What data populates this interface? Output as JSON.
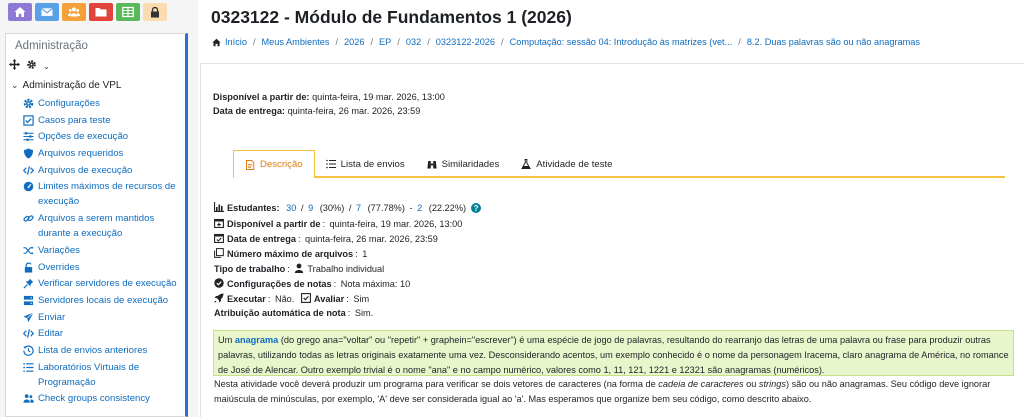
{
  "page_title": "0323122 - Módulo de Fundamentos 1 (2026)",
  "breadcrumb": [
    "Início",
    "Meus Ambientes",
    "2026",
    "EP",
    "032",
    "0323122-2026",
    "Computação: sessão 04: Introdução às matrizes (vet...",
    "8.2. Duas palavras são ou não anagramas"
  ],
  "colors": {
    "accent": "#f5c242",
    "link": "#0f6cbf",
    "tab_active": "#e07b12",
    "highlight_bg": "#e9f6cc"
  },
  "quick_links": [
    {
      "icon": "home-icon",
      "color": "#8e79d6"
    },
    {
      "icon": "mail-icon",
      "color": "#5aa2e8"
    },
    {
      "icon": "users-icon",
      "color": "#f5a03a"
    },
    {
      "icon": "folder-icon",
      "color": "#e0443a"
    },
    {
      "icon": "table-icon",
      "color": "#5cb85c"
    },
    {
      "icon": "lock-icon",
      "color": "#fbdcb0"
    }
  ],
  "admin": {
    "title": "Administração",
    "section": "Administração de VPL",
    "items": [
      {
        "label": "Configurações",
        "icon": "gear-icon"
      },
      {
        "label": "Casos para teste",
        "icon": "checkbox-icon"
      },
      {
        "label": "Opções de execução",
        "icon": "sliders-icon"
      },
      {
        "label": "Arquivos requeridos",
        "icon": "shield-icon"
      },
      {
        "label": "Arquivos de execução",
        "icon": "code-icon"
      },
      {
        "label": "Limites máximos de recursos de execução",
        "icon": "gauge-icon"
      },
      {
        "label": "Arquivos a serem mantidos durante a execução",
        "icon": "link-icon"
      },
      {
        "label": "Variações",
        "icon": "shuffle-icon"
      },
      {
        "label": "Overrides",
        "icon": "unlock-icon"
      },
      {
        "label": "Verificar servidores de execução",
        "icon": "pin-icon"
      },
      {
        "label": "Servidores locais de execução",
        "icon": "server-icon"
      },
      {
        "label": "Enviar",
        "icon": "send-icon"
      },
      {
        "label": "Editar",
        "icon": "code-icon"
      },
      {
        "label": "Lista de envios anteriores",
        "icon": "history-icon"
      },
      {
        "label": "Laboratórios Virtuais de Programação",
        "icon": "list-icon"
      },
      {
        "label": "Check groups consistency",
        "icon": "users-icon"
      }
    ]
  },
  "dates": {
    "available_label": "Disponível a partir de:",
    "available_value": "quinta-feira, 19 mar. 2026, 13:00",
    "due_label": "Data de entrega:",
    "due_value": "quinta-feira, 26 mar. 2026, 23:59"
  },
  "tabs": [
    {
      "label": "Descrição",
      "icon": "doc-icon",
      "active": true
    },
    {
      "label": "Lista de envios",
      "icon": "list-icon",
      "active": false
    },
    {
      "label": "Similaridades",
      "icon": "binoculars-icon",
      "active": false
    },
    {
      "label": "Atividade de teste",
      "icon": "flask-icon",
      "active": false
    }
  ],
  "details": {
    "students_label": "Estudantes:",
    "students_total": "30",
    "students_a": "9",
    "students_a_pct": "(30%)",
    "students_b": "7",
    "students_b_pct": "(77.78%)",
    "students_c": "2",
    "students_c_pct": "(22.22%)",
    "available_label": "Disponível a partir de",
    "available_value": "quinta-feira, 19 mar. 2026, 13:00",
    "due_label": "Data de entrega",
    "due_value": "quinta-feira, 26 mar. 2026, 23:59",
    "maxfiles_label": "Número máximo de arquivos",
    "maxfiles_value": "1",
    "worktype_label": "Tipo de trabalho",
    "worktype_value": "Trabalho individual",
    "grade_label": "Configurações de notas",
    "grade_value": "Nota máxima: 10",
    "run_label": "Executar",
    "run_value": "Não.",
    "eval_label": "Avaliar",
    "eval_value": "Sim",
    "autograde_label": "Atribuição automática de nota",
    "autograde_value": "Sim."
  },
  "description": {
    "p1_pre": "Um ",
    "p1_keyword": "anagrama",
    "p1_text": " (do grego ana=\"voltar\" ou \"repetir\" + graphein=\"escrever\") é uma espécie de jogo de palavras, resultando do rearranjo das letras de uma palavra ou frase para produzir outras palavras, utilizando todas as letras originais exatamente uma vez. Desconsiderando acentos, um exemplo conhecido é o nome da personagem Iracema, claro anagrama de América, no romance de José de Alencar. Outro exemplo trivial é o nome \"ana\" e no campo numérico, valores como 1, 11, 121, 1221 e 12321 são anagramas (numéricos).",
    "p2_a": "Nesta atividade você deverá produzir um programa para verificar se dois vetores de caracteres (na forma de ",
    "p2_b": "cadeia de caracteres",
    "p2_c": " ou ",
    "p2_d": "strings",
    "p2_e": ") são ou não anagramas. Seu código deve ignorar maiúscula de minúsculas, por exemplo, 'A' deve ser considerada igual ao 'a'. Mas esperamos que organize bem seu código, como descrito abaixo."
  }
}
